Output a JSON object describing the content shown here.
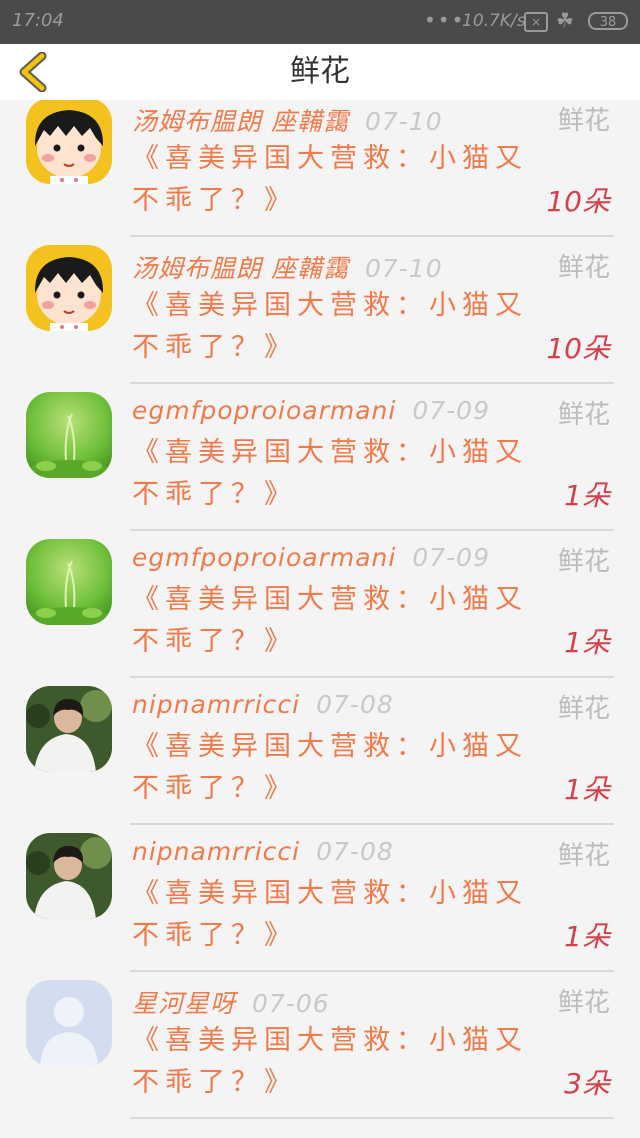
{
  "status_bar": {
    "time": "17:04",
    "signal_dots": "•••",
    "speed": "10.7K/s",
    "battery": "38"
  },
  "header": {
    "title": "鲜花"
  },
  "gift_label": "鲜花",
  "colors": {
    "accent_orange": "#f07a4a",
    "count_red": "#d6404a",
    "back_yellow": "#f2c20c"
  },
  "items": [
    {
      "username": "汤姆布腽朗 座韛靄",
      "date": "07-10",
      "message": "《喜美异国大营救：小猫又不乖了？》",
      "count": "10朵",
      "avatar": "cartoon-girl"
    },
    {
      "username": "汤姆布腽朗 座韛靄",
      "date": "07-10",
      "message": "《喜美异国大营救：小猫又不乖了？》",
      "count": "10朵",
      "avatar": "cartoon-girl"
    },
    {
      "username": "egmfpoproioarmani",
      "date": "07-09",
      "message": "《喜美异国大营救：小猫又不乖了？》",
      "count": "1朵",
      "avatar": "green-plant"
    },
    {
      "username": "egmfpoproioarmani",
      "date": "07-09",
      "message": "《喜美异国大营救：小猫又不乖了？》",
      "count": "1朵",
      "avatar": "green-plant"
    },
    {
      "username": "nipnamrricci",
      "date": "07-08",
      "message": "《喜美异国大营救：小猫又不乖了？》",
      "count": "1朵",
      "avatar": "person-photo"
    },
    {
      "username": "nipnamrricci",
      "date": "07-08",
      "message": "《喜美异国大营救：小猫又不乖了？》",
      "count": "1朵",
      "avatar": "person-photo"
    },
    {
      "username": "星河星呀",
      "date": "07-06",
      "message": "《喜美异国大营救：小猫又不乖了？》",
      "count": "3朵",
      "avatar": "default-person"
    }
  ]
}
